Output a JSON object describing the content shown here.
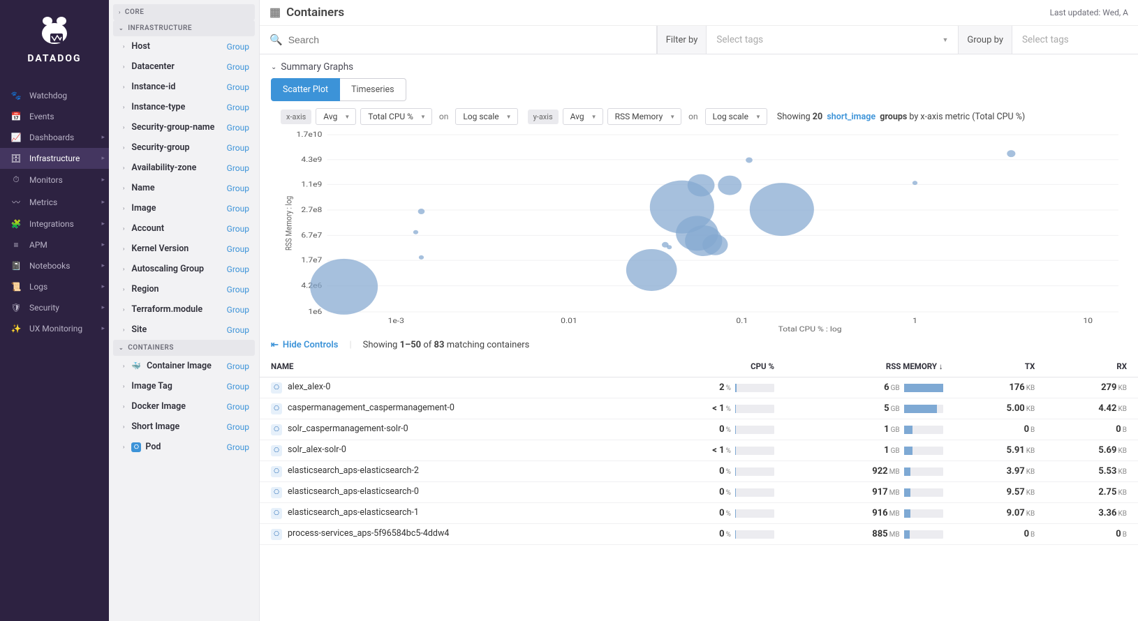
{
  "brand": "DATADOG",
  "header": {
    "title": "Containers",
    "lastUpdated": "Last updated: Wed, A"
  },
  "nav": [
    {
      "icon": "🐾",
      "label": "Watchdog"
    },
    {
      "icon": "📅",
      "label": "Events"
    },
    {
      "icon": "📈",
      "label": "Dashboards",
      "caret": true
    },
    {
      "icon": "🗄",
      "label": "Infrastructure",
      "caret": true,
      "active": true
    },
    {
      "icon": "⏱",
      "label": "Monitors",
      "caret": true
    },
    {
      "icon": "〰",
      "label": "Metrics",
      "caret": true
    },
    {
      "icon": "🧩",
      "label": "Integrations",
      "caret": true
    },
    {
      "icon": "≡",
      "label": "APM",
      "caret": true
    },
    {
      "icon": "📓",
      "label": "Notebooks",
      "caret": true
    },
    {
      "icon": "📜",
      "label": "Logs",
      "caret": true
    },
    {
      "icon": "🛡",
      "label": "Security",
      "caret": true
    },
    {
      "icon": "✨",
      "label": "UX Monitoring",
      "caret": true
    }
  ],
  "facetSections": [
    {
      "name": "CORE",
      "open": false,
      "items": []
    },
    {
      "name": "INFRASTRUCTURE",
      "open": true,
      "items": [
        {
          "label": "Host"
        },
        {
          "label": "Datacenter"
        },
        {
          "label": "Instance-id"
        },
        {
          "label": "Instance-type"
        },
        {
          "label": "Security-group-name"
        },
        {
          "label": "Security-group"
        },
        {
          "label": "Availability-zone"
        },
        {
          "label": "Name"
        },
        {
          "label": "Image"
        },
        {
          "label": "Account"
        },
        {
          "label": "Kernel Version"
        },
        {
          "label": "Autoscaling Group"
        },
        {
          "label": "Region"
        },
        {
          "label": "Terraform.module"
        },
        {
          "label": "Site"
        }
      ]
    },
    {
      "name": "CONTAINERS",
      "open": true,
      "items": [
        {
          "label": "Container Image",
          "iconType": "docker"
        },
        {
          "label": "Image Tag"
        },
        {
          "label": "Docker Image"
        },
        {
          "label": "Short Image"
        },
        {
          "label": "Pod",
          "iconType": "k8s"
        }
      ]
    }
  ],
  "facetGroupAction": "Group",
  "search": {
    "placeholder": "Search",
    "filterByLabel": "Filter by",
    "filterByPlaceholder": "Select tags",
    "groupByLabel": "Group by",
    "groupByPlaceholder": "Select tags"
  },
  "summaryLabel": "Summary Graphs",
  "tabs": [
    {
      "label": "Scatter Plot",
      "active": true
    },
    {
      "label": "Timeseries"
    }
  ],
  "scatterControls": {
    "xAxisLabel": "x-axis",
    "yAxisLabel": "y-axis",
    "agg": "Avg",
    "xMetric": "Total CPU %",
    "yMetric": "RSS Memory",
    "on": "on",
    "scale": "Log scale",
    "showingText": {
      "prefix": "Showing",
      "count": "20",
      "linkText": "short_image",
      "groups": "groups",
      "suffix": "by x-axis metric (Total CPU %)"
    }
  },
  "chart_data": {
    "type": "scatter",
    "title": "",
    "xlabel": "Total CPU % : log",
    "ylabel": "RSS Memory : log",
    "x_ticks": [
      "1e-3",
      "0.01",
      "0.1",
      "1",
      "10"
    ],
    "y_ticks": [
      "1e6",
      "4.2e6",
      "1.7e7",
      "6.7e7",
      "2.7e8",
      "1.1e9",
      "4.3e9",
      "1.7e10"
    ],
    "series": [
      {
        "name": "short_image",
        "points": [
          {
            "x": 0.0005,
            "y": 4000000.0,
            "size": 40
          },
          {
            "x": 0.0013,
            "y": 80000000.0,
            "size": 3
          },
          {
            "x": 0.0014,
            "y": 20000000.0,
            "size": 3
          },
          {
            "x": 0.0014,
            "y": 250000000.0,
            "size": 4
          },
          {
            "x": 0.03,
            "y": 10000000.0,
            "size": 30
          },
          {
            "x": 0.036,
            "y": 40000000.0,
            "size": 4
          },
          {
            "x": 0.038,
            "y": 35000000.0,
            "size": 3
          },
          {
            "x": 0.045,
            "y": 320000000.0,
            "size": 38
          },
          {
            "x": 0.055,
            "y": 75000000.0,
            "size": 25
          },
          {
            "x": 0.058,
            "y": 1050000000.0,
            "size": 16
          },
          {
            "x": 0.06,
            "y": 50000000.0,
            "size": 22
          },
          {
            "x": 0.07,
            "y": 40000000.0,
            "size": 15
          },
          {
            "x": 0.085,
            "y": 1050000000.0,
            "size": 14
          },
          {
            "x": 0.11,
            "y": 4200000000.0,
            "size": 4
          },
          {
            "x": 0.17,
            "y": 280000000.0,
            "size": 38
          },
          {
            "x": 1.0,
            "y": 1200000000.0,
            "size": 3
          },
          {
            "x": 3.6,
            "y": 6000000000.0,
            "size": 5
          }
        ]
      }
    ]
  },
  "hideControlsLabel": "Hide Controls",
  "resultCount": {
    "prefix": "Showing",
    "range": "1–50",
    "of": "of",
    "total": "83",
    "suffix": "matching containers"
  },
  "columns": [
    "NAME",
    "CPU %",
    "RSS MEMORY ↓",
    "TX",
    "RX"
  ],
  "rows": [
    {
      "name": "alex_alex-0",
      "cpu": "2",
      "cpu_unit": "%",
      "cpu_bar": 4,
      "rss": "6",
      "rss_unit": "GB",
      "rss_bar": 100,
      "tx": "176",
      "tx_unit": "KB",
      "rx": "279",
      "rx_unit": "KB"
    },
    {
      "name": "caspermanagement_caspermanagement-0",
      "cpu": "< 1",
      "cpu_unit": "%",
      "cpu_bar": 2,
      "rss": "5",
      "rss_unit": "GB",
      "rss_bar": 85,
      "tx": "5.00",
      "tx_unit": "KB",
      "rx": "4.42",
      "rx_unit": "KB"
    },
    {
      "name": "solr_caspermanagement-solr-0",
      "cpu": "0",
      "cpu_unit": "%",
      "cpu_bar": 1,
      "rss": "1",
      "rss_unit": "GB",
      "rss_bar": 22,
      "tx": "0",
      "tx_unit": "B",
      "rx": "0",
      "rx_unit": "B"
    },
    {
      "name": "solr_alex-solr-0",
      "cpu": "< 1",
      "cpu_unit": "%",
      "cpu_bar": 2,
      "rss": "1",
      "rss_unit": "GB",
      "rss_bar": 22,
      "tx": "5.91",
      "tx_unit": "KB",
      "rx": "5.69",
      "rx_unit": "KB"
    },
    {
      "name": "elasticsearch_aps-elasticsearch-2",
      "cpu": "0",
      "cpu_unit": "%",
      "cpu_bar": 1,
      "rss": "922",
      "rss_unit": "MB",
      "rss_bar": 16,
      "tx": "3.97",
      "tx_unit": "KB",
      "rx": "5.53",
      "rx_unit": "KB"
    },
    {
      "name": "elasticsearch_aps-elasticsearch-0",
      "cpu": "0",
      "cpu_unit": "%",
      "cpu_bar": 1,
      "rss": "917",
      "rss_unit": "MB",
      "rss_bar": 16,
      "tx": "9.57",
      "tx_unit": "KB",
      "rx": "2.75",
      "rx_unit": "KB"
    },
    {
      "name": "elasticsearch_aps-elasticsearch-1",
      "cpu": "0",
      "cpu_unit": "%",
      "cpu_bar": 1,
      "rss": "916",
      "rss_unit": "MB",
      "rss_bar": 16,
      "tx": "9.07",
      "tx_unit": "KB",
      "rx": "3.36",
      "rx_unit": "KB"
    },
    {
      "name": "process-services_aps-5f96584bc5-4ddw4",
      "cpu": "0",
      "cpu_unit": "%",
      "cpu_bar": 1,
      "rss": "885",
      "rss_unit": "MB",
      "rss_bar": 15,
      "tx": "0",
      "tx_unit": "B",
      "rx": "0",
      "rx_unit": "B"
    }
  ]
}
